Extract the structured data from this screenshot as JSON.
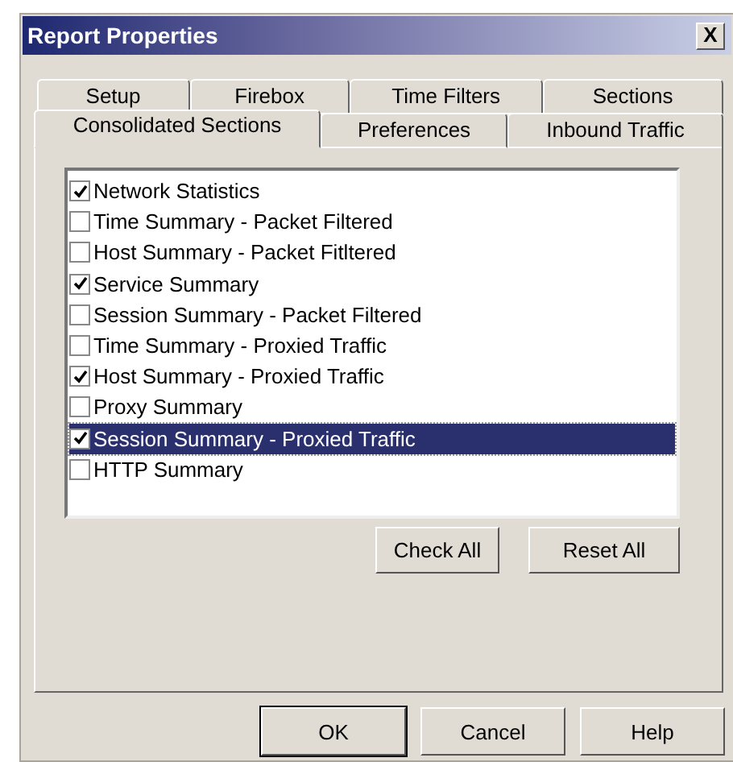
{
  "window": {
    "title": "Report Properties",
    "close": "X"
  },
  "tab_rows": [
    [
      {
        "label": "Setup",
        "selected": false
      },
      {
        "label": "Firebox",
        "selected": false
      },
      {
        "label": "Time Filters",
        "selected": false
      },
      {
        "label": "Sections",
        "selected": false
      }
    ],
    [
      {
        "label": "Consolidated Sections",
        "selected": true
      },
      {
        "label": "Preferences",
        "selected": false
      },
      {
        "label": "Inbound Traffic",
        "selected": false
      }
    ]
  ],
  "sections": [
    {
      "label": "Network Statistics",
      "checked": true,
      "selected": false
    },
    {
      "label": "Time Summary - Packet Filtered",
      "checked": false,
      "selected": false
    },
    {
      "label": "Host Summary - Packet Fitltered",
      "checked": false,
      "selected": false
    },
    {
      "label": "Service Summary",
      "checked": true,
      "selected": false
    },
    {
      "label": "Session Summary - Packet Filtered",
      "checked": false,
      "selected": false
    },
    {
      "label": "Time Summary - Proxied Traffic",
      "checked": false,
      "selected": false
    },
    {
      "label": "Host Summary - Proxied Traffic",
      "checked": true,
      "selected": false
    },
    {
      "label": "Proxy Summary",
      "checked": false,
      "selected": false
    },
    {
      "label": "Session Summary - Proxied Traffic",
      "checked": true,
      "selected": true
    },
    {
      "label": "HTTP Summary",
      "checked": false,
      "selected": false
    }
  ],
  "list_buttons": [
    "Check All",
    "Reset All"
  ],
  "dialog_buttons": [
    {
      "label": "OK",
      "default": true
    },
    {
      "label": "Cancel",
      "default": false
    },
    {
      "label": "Help",
      "default": false
    }
  ]
}
